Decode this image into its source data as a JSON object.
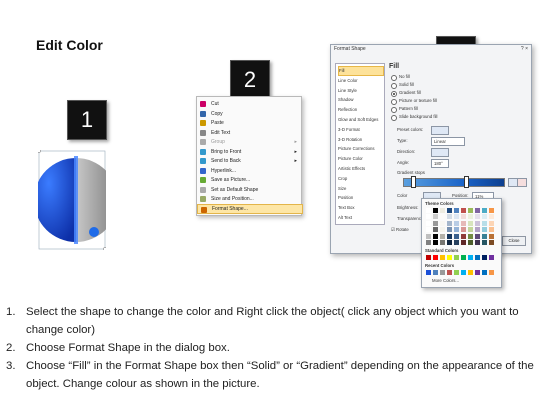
{
  "title": "Edit Color",
  "badges": [
    "1",
    "2",
    "3"
  ],
  "shape": {
    "left_color": "#1a4fd8",
    "right_color": "#9a9a9a"
  },
  "context_menu": {
    "items": [
      {
        "label": "Cut",
        "disabled": false,
        "submenu": false
      },
      {
        "label": "Copy",
        "disabled": false,
        "submenu": false
      },
      {
        "label": "Paste",
        "disabled": false,
        "submenu": false
      },
      {
        "label": "Edit Text",
        "disabled": false,
        "submenu": false
      },
      {
        "label": "Group",
        "disabled": true,
        "submenu": true
      },
      {
        "label": "Bring to Front",
        "disabled": false,
        "submenu": true
      },
      {
        "label": "Send to Back",
        "disabled": false,
        "submenu": true
      },
      {
        "label": "Hyperlink...",
        "disabled": false,
        "submenu": false
      },
      {
        "label": "Save as Picture...",
        "disabled": false,
        "submenu": false
      },
      {
        "label": "Set as Default Shape",
        "disabled": false,
        "submenu": false
      },
      {
        "label": "Size and Position...",
        "disabled": false,
        "submenu": false
      },
      {
        "label": "Format Shape...",
        "disabled": false,
        "submenu": false,
        "highlighted": true
      }
    ]
  },
  "dialog": {
    "title": "Format Shape",
    "controls": "? ×",
    "nav": [
      "Fill",
      "Line Color",
      "Line Style",
      "Shadow",
      "Reflection",
      "Glow and Soft Edges",
      "3-D Format",
      "3-D Rotation",
      "Picture Corrections",
      "Picture Color",
      "Artistic Effects",
      "Crop",
      "Size",
      "Position",
      "Text Box",
      "Alt Text"
    ],
    "fill_heading": "Fill",
    "fill_options": [
      "No fill",
      "Solid fill",
      "Gradient fill",
      "Picture or texture fill",
      "Pattern fill",
      "Slide background fill"
    ],
    "selected_fill": 2,
    "preset_label": "Preset colors:",
    "type_label": "Type:",
    "type_value": "Linear",
    "direction_label": "Direction:",
    "angle_label": "Angle:",
    "angle_value": "180°",
    "stops_label": "Gradient stops",
    "color_label": "Color",
    "position_label": "Position:",
    "position_value": "11%",
    "brightness_label": "Brightness:",
    "transparency_label": "Transparency:",
    "rotate_label": "Rotate",
    "close_label": "Close"
  },
  "palette": {
    "theme_heading": "Theme Colors",
    "standard_heading": "Standard Colors",
    "recent_heading": "Recent Colors",
    "more_label": "More Colors...",
    "theme_top": [
      "#ffffff",
      "#000000",
      "#eeece1",
      "#1f497d",
      "#4f81bd",
      "#c0504d",
      "#9bbb59",
      "#8064a2",
      "#4bacc6",
      "#f79646"
    ],
    "standard": [
      "#c00000",
      "#ff0000",
      "#ffc000",
      "#ffff00",
      "#92d050",
      "#00b050",
      "#00b0f0",
      "#0070c0",
      "#002060",
      "#7030a0"
    ],
    "recent": [
      "#1a4fd8",
      "#4f81bd",
      "#9a9a9a",
      "#c0504d",
      "#92d050",
      "#00b0f0",
      "#ffc000",
      "#7030a0",
      "#0070c0",
      "#f79646"
    ]
  },
  "instructions": [
    {
      "num": "1.",
      "text": "Select the shape to change the color and Right click the object( click any object which you want to change color)"
    },
    {
      "num": "2.",
      "text": "Choose Format Shape in the dialog box."
    },
    {
      "num": "3.",
      "text": "Choose “Fill” in the Format Shape box then “Solid” or “Gradient” depending on the appearance of the object. Change colour as shown in the picture."
    }
  ]
}
